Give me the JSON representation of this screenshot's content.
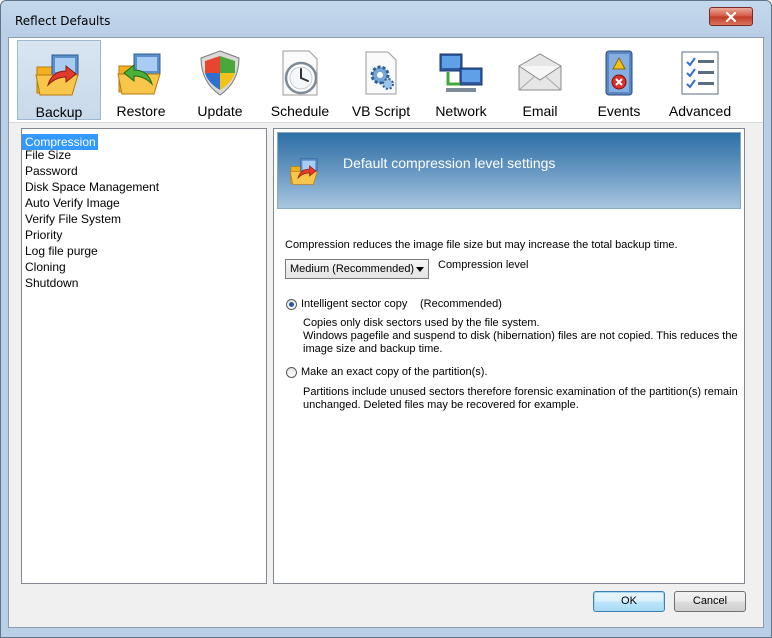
{
  "window": {
    "title": "Reflect Defaults"
  },
  "toolbar": {
    "items": [
      {
        "label": "Backup",
        "icon": "backup-icon",
        "active": true
      },
      {
        "label": "Restore",
        "icon": "restore-icon"
      },
      {
        "label": "Update",
        "icon": "update-shield-icon"
      },
      {
        "label": "Schedule",
        "icon": "schedule-clock-icon"
      },
      {
        "label": "VB Script",
        "icon": "vbscript-icon"
      },
      {
        "label": "Network",
        "icon": "network-icon"
      },
      {
        "label": "Email",
        "icon": "email-icon"
      },
      {
        "label": "Events",
        "icon": "events-log-icon"
      },
      {
        "label": "Advanced",
        "icon": "advanced-checklist-icon"
      }
    ]
  },
  "sidebar": {
    "items": [
      {
        "label": "Compression",
        "selected": true
      },
      {
        "label": "File Size"
      },
      {
        "label": "Password"
      },
      {
        "label": "Disk Space Management"
      },
      {
        "label": "Auto Verify Image"
      },
      {
        "label": "Verify File System"
      },
      {
        "label": "Priority"
      },
      {
        "label": "Log file purge"
      },
      {
        "label": "Cloning"
      },
      {
        "label": "Shutdown"
      }
    ]
  },
  "panel": {
    "banner_title": "Default compression level settings",
    "description": "Compression reduces the image file size but may increase the total backup time.",
    "compression_select_value": "Medium (Recommended)",
    "compression_label": "Compression level",
    "option1": {
      "label": "Intelligent sector copy",
      "tag": "(Recommended)",
      "line1": "Copies only disk sectors used by the file system.",
      "line2": "Windows pagefile and suspend to disk (hibernation) files are not copied. This reduces the",
      "line3": "image size and backup time.",
      "checked": true
    },
    "option2": {
      "label": "Make an exact copy of the partition(s).",
      "line1": "Partitions include unused sectors therefore forensic examination of the partition(s) remain",
      "line2": "unchanged. Deleted files may be recovered for example.",
      "checked": false
    }
  },
  "footer": {
    "ok_label": "OK",
    "cancel_label": "Cancel"
  },
  "colors": {
    "selection": "#3399ff",
    "banner": "#2d6fa5",
    "accent": "#3c7fb1"
  }
}
